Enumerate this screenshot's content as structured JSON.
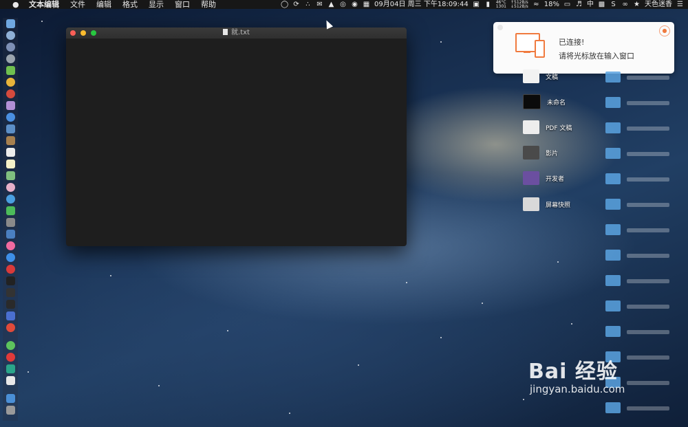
{
  "menubar": {
    "apple_icon": "apple-icon",
    "app_name": "文本编辑",
    "menus": [
      "文件",
      "编辑",
      "格式",
      "显示",
      "窗口",
      "帮助"
    ],
    "datetime": "09月04日 周三 下午18:09:44",
    "temp": "46°C",
    "temp_sub": "1301",
    "net_up": "↑512B/s",
    "net_down": "↓512B/s",
    "battery": "18%",
    "input_method": "中",
    "user": "天色迷香"
  },
  "window": {
    "title": "就.txt"
  },
  "notification": {
    "line1": "已连接!",
    "line2": "请将光标放在输入窗口"
  },
  "desktop_icons": [
    {
      "label": "文稿"
    },
    {
      "label": "未命名"
    },
    {
      "label": "PDF 文稿"
    },
    {
      "label": "影片"
    },
    {
      "label": "开发者"
    },
    {
      "label": "屏幕快照"
    }
  ],
  "watermark": {
    "brand": "Bai 经验",
    "url": "jingyan.baidu.com"
  },
  "colors": {
    "accent": "#f07a3e",
    "window_bg": "#1e1e1e",
    "menubar_bg": "#171717"
  }
}
